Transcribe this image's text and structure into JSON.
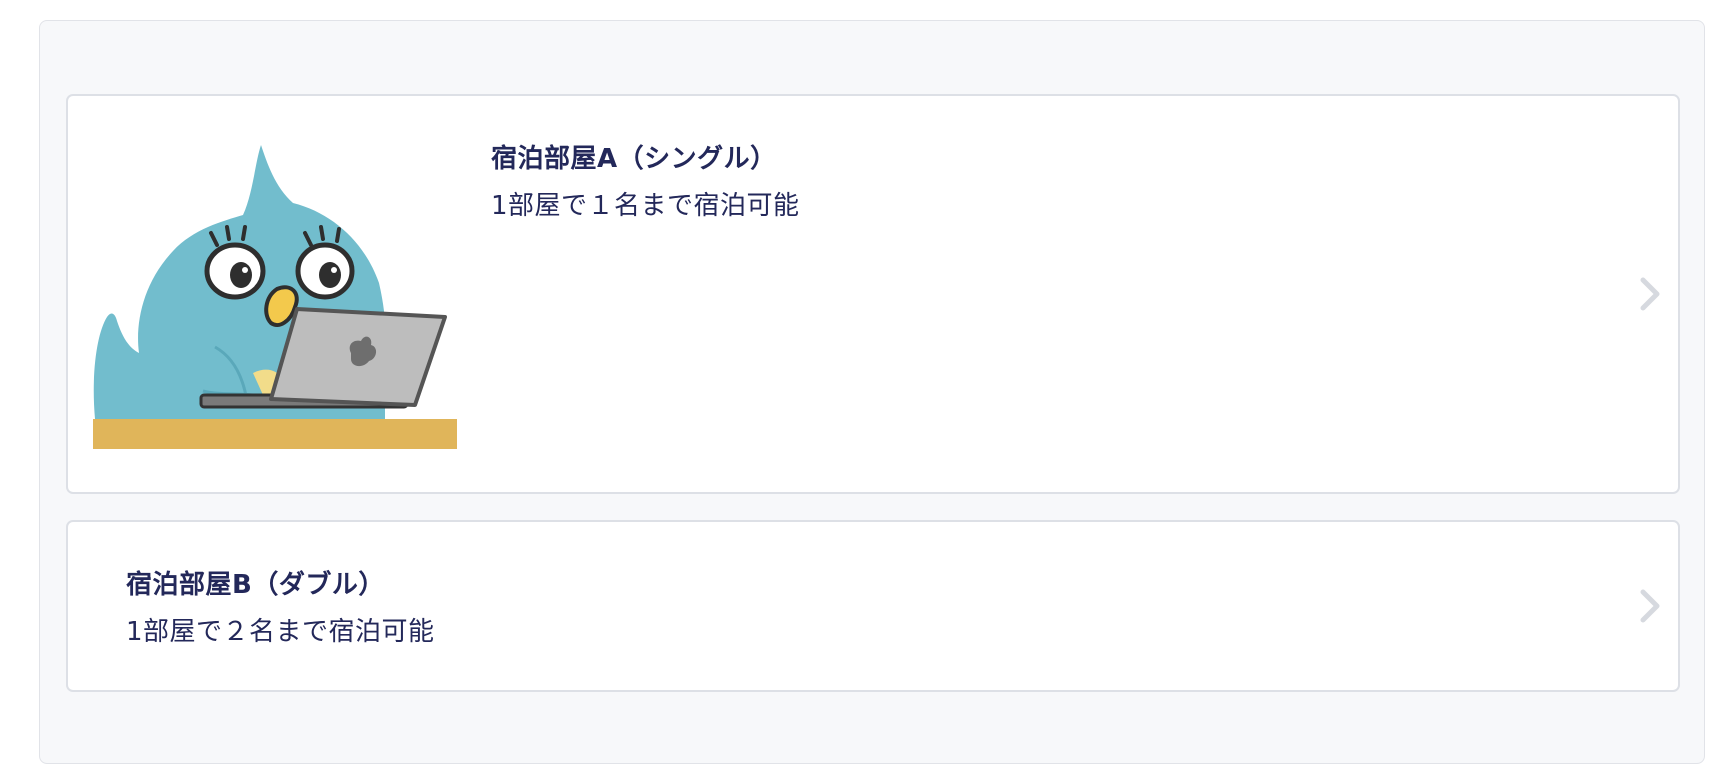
{
  "rooms": [
    {
      "title": "宿泊部屋A（シングル）",
      "description": "1部屋で１名まで宿泊可能",
      "has_image": true,
      "image_icon": "bird-laptop-illustration"
    },
    {
      "title": "宿泊部屋B（ダブル）",
      "description": "1部屋で２名まで宿泊可能",
      "has_image": false
    }
  ],
  "colors": {
    "title_text": "#23285a",
    "panel_bg": "#f7f8fa",
    "card_border": "#dde0e6",
    "chevron": "#d6d9df",
    "bird_body": "#72bdcd",
    "desk": "#e0b55a",
    "laptop": "#bdbdbd"
  }
}
